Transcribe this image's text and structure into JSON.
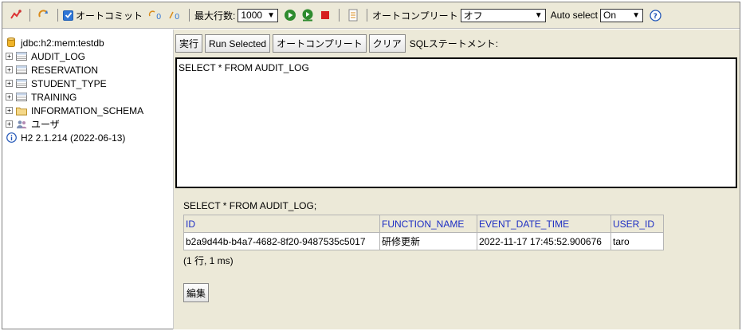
{
  "toolbar": {
    "autocommit_label": "オートコミット",
    "max_rows_label": "最大行数:",
    "max_rows_value": "1000",
    "autocomplete_label": "オートコンプリート",
    "autocomplete_value": "オフ",
    "autoselect_label": "Auto select",
    "autoselect_value": "On"
  },
  "tree": {
    "connection": "jdbc:h2:mem:testdb",
    "items": [
      {
        "label": "AUDIT_LOG",
        "icon": "table-icon"
      },
      {
        "label": "RESERVATION",
        "icon": "table-icon"
      },
      {
        "label": "STUDENT_TYPE",
        "icon": "table-icon"
      },
      {
        "label": "TRAINING",
        "icon": "table-icon"
      },
      {
        "label": "INFORMATION_SCHEMA",
        "icon": "folder-icon"
      },
      {
        "label": "ユーザ",
        "icon": "users-icon"
      }
    ],
    "version": "H2 2.1.214 (2022-06-13)"
  },
  "editor_bar": {
    "run": "実行",
    "run_selected": "Run Selected",
    "autocomplete": "オートコンプリート",
    "clear": "クリア",
    "sql_label": "SQLステートメント:"
  },
  "editor": {
    "sql": "SELECT * FROM AUDIT_LOG"
  },
  "result": {
    "query": "SELECT * FROM AUDIT_LOG;",
    "columns": [
      "ID",
      "FUNCTION_NAME",
      "EVENT_DATE_TIME",
      "USER_ID"
    ],
    "rows": [
      [
        "b2a9d44b-b4a7-4682-8f20-9487535c5017",
        "研修更新",
        "2022-11-17 17:45:52.900676",
        "taro"
      ]
    ],
    "row_count": "(1 行, 1 ms)",
    "edit_button": "編集"
  },
  "colors": {
    "panel_bg": "#ece9d8",
    "header_link": "#1d2ec3",
    "run_green": "#2e8b2e",
    "stop_red": "#d62020"
  }
}
